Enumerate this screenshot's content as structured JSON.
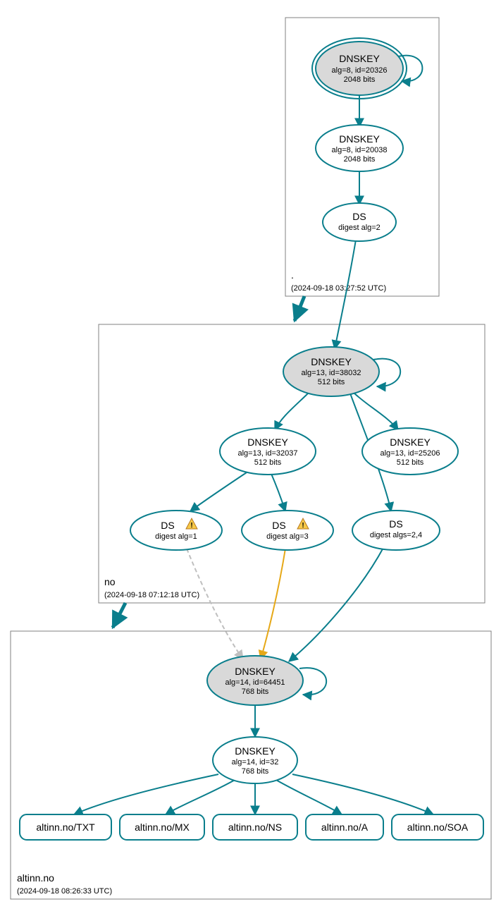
{
  "colors": {
    "teal": "#0a7e8c",
    "warning": "#e6a817",
    "grey_node": "#d9d9d9",
    "grey_edge": "#bfbfbf",
    "box_stroke": "#808080"
  },
  "zones": {
    "root": {
      "label": ".",
      "timestamp": "(2024-09-18 03:27:52 UTC)"
    },
    "no": {
      "label": "no",
      "timestamp": "(2024-09-18 07:12:18 UTC)"
    },
    "altinn": {
      "label": "altinn.no",
      "timestamp": "(2024-09-18 08:26:33 UTC)"
    }
  },
  "nodes": {
    "root_ksk": {
      "title": "DNSKEY",
      "line2": "alg=8, id=20326",
      "line3": "2048 bits"
    },
    "root_zsk": {
      "title": "DNSKEY",
      "line2": "alg=8, id=20038",
      "line3": "2048 bits"
    },
    "root_ds": {
      "title": "DS",
      "line2": "digest alg=2"
    },
    "no_ksk": {
      "title": "DNSKEY",
      "line2": "alg=13, id=38032",
      "line3": "512 bits"
    },
    "no_zsk1": {
      "title": "DNSKEY",
      "line2": "alg=13, id=32037",
      "line3": "512 bits"
    },
    "no_zsk2": {
      "title": "DNSKEY",
      "line2": "alg=13, id=25206",
      "line3": "512 bits"
    },
    "no_ds1": {
      "title": "DS",
      "line2": "digest alg=1",
      "warning": true
    },
    "no_ds2": {
      "title": "DS",
      "line2": "digest alg=3",
      "warning": true
    },
    "no_ds3": {
      "title": "DS",
      "line2": "digest algs=2,4"
    },
    "altinn_ksk": {
      "title": "DNSKEY",
      "line2": "alg=14, id=64451",
      "line3": "768 bits"
    },
    "altinn_zsk": {
      "title": "DNSKEY",
      "line2": "alg=14, id=32",
      "line3": "768 bits"
    }
  },
  "rrsets": {
    "txt": "altinn.no/TXT",
    "mx": "altinn.no/MX",
    "ns": "altinn.no/NS",
    "a": "altinn.no/A",
    "soa": "altinn.no/SOA"
  },
  "icons": {
    "warning_glyph": "!"
  }
}
